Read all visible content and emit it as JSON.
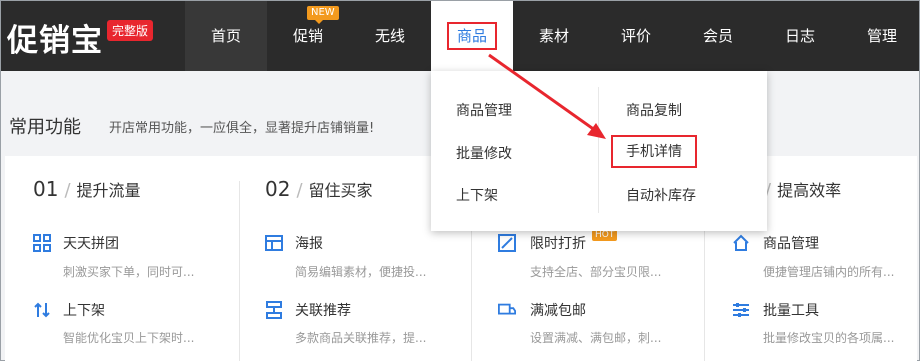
{
  "brand": {
    "logo_text": "促销宝",
    "edition_badge": "完整版"
  },
  "nav": {
    "items": [
      {
        "label": "首页"
      },
      {
        "label": "促销",
        "badge": "NEW"
      },
      {
        "label": "无线"
      },
      {
        "label": "商品"
      },
      {
        "label": "素材"
      },
      {
        "label": "评价"
      },
      {
        "label": "会员"
      },
      {
        "label": "日志"
      },
      {
        "label": "管理"
      }
    ]
  },
  "section": {
    "title": "常用功能",
    "subtitle": "开店常用功能，一应俱全，显著提升店铺销量!"
  },
  "columns": [
    {
      "num": "01",
      "title": "提升流量",
      "features": [
        {
          "icon": "grid-icon",
          "name": "天天拼团",
          "desc": "刺激买家下单，同时可..."
        },
        {
          "icon": "up-down-arrows-icon",
          "name": "上下架",
          "desc": "智能优化宝贝上下架时..."
        }
      ]
    },
    {
      "num": "02",
      "title": "留住买家",
      "features": [
        {
          "icon": "layout-icon",
          "name": "海报",
          "desc": "简易编辑素材，便捷投..."
        },
        {
          "icon": "link-recommend-icon",
          "name": "关联推荐",
          "desc": "多款商品关联推荐，提..."
        }
      ]
    },
    {
      "num": "",
      "title": "",
      "features": [
        {
          "icon": "discount-icon",
          "name": "限时打折",
          "desc": "支持全店、部分宝贝限...",
          "badge": "HOT"
        },
        {
          "icon": "delivery-truck-icon",
          "name": "满减包邮",
          "desc": "设置满减、满包邮，刺..."
        }
      ]
    },
    {
      "num": "",
      "title": "提高效率",
      "features": [
        {
          "icon": "home-edit-icon",
          "name": "商品管理",
          "desc": "便捷管理店铺内的所有..."
        },
        {
          "icon": "sliders-icon",
          "name": "批量工具",
          "desc": "批量修改宝贝的各项属..."
        }
      ]
    }
  ],
  "dropdown": {
    "left": [
      "商品管理",
      "批量修改",
      "上下架"
    ],
    "right": [
      "商品复制",
      "手机详情",
      "自动补库存"
    ]
  },
  "colors": {
    "accent": "#2f7ce0",
    "highlight": "#e8262e",
    "topbar": "#2b2b2b"
  }
}
